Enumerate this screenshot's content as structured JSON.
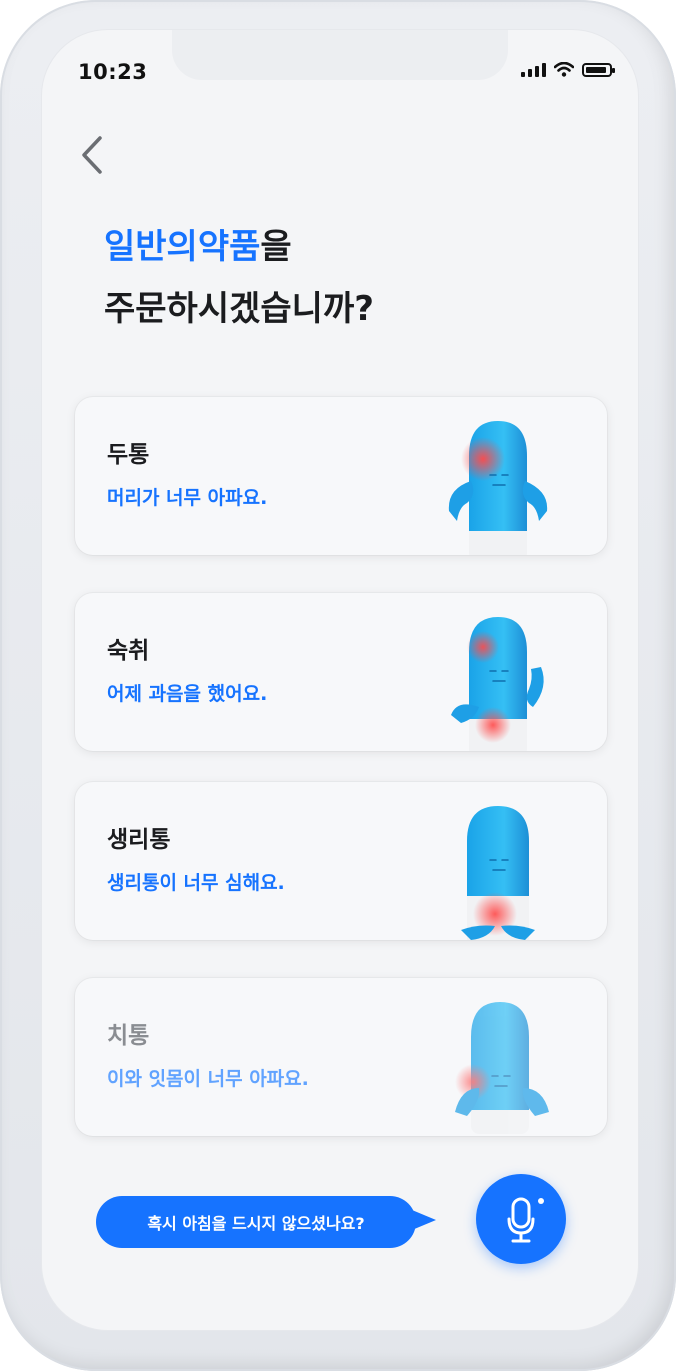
{
  "status_bar": {
    "time": "10:23"
  },
  "header": {
    "title_highlight": "일반의약품",
    "title_suffix": "을",
    "title_line2": "주문하시겠습니까?"
  },
  "options": [
    {
      "title": "두통",
      "description": "머리가 너무 아파요.",
      "icon": "headache-mascot-icon"
    },
    {
      "title": "숙취",
      "description": "어제 과음을 했어요.",
      "icon": "hangover-mascot-icon"
    },
    {
      "title": "생리통",
      "description": "생리통이 너무 심해요.",
      "icon": "menstrual-pain-mascot-icon"
    },
    {
      "title": "치통",
      "description": "이와 잇몸이 너무 아파요.",
      "icon": "toothache-mascot-icon"
    }
  ],
  "assistant": {
    "prompt": "혹시 아침을 드시지 않으셨나요?",
    "mic_icon": "microphone-icon"
  },
  "colors": {
    "accent": "#1673ff",
    "mascot": "#2fb6f0",
    "pain": "#ff5b5b"
  }
}
